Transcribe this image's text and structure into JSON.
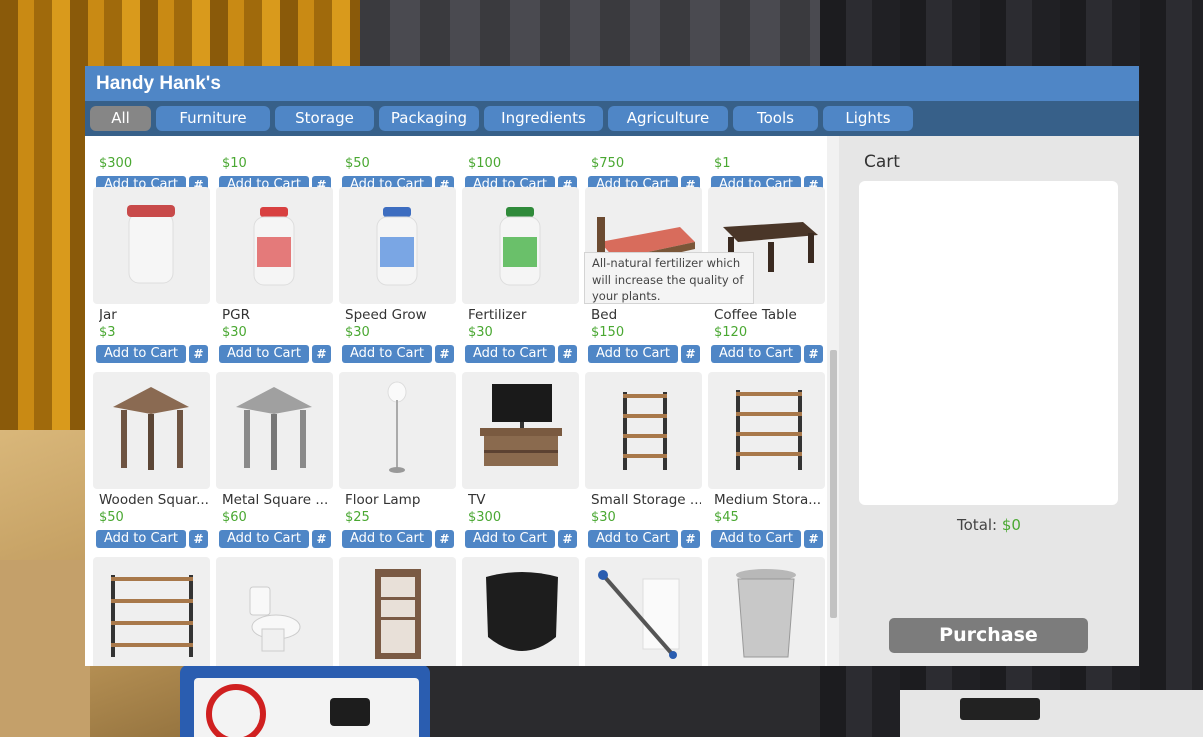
{
  "shop": {
    "title": "Handy Hank's",
    "tabs": [
      {
        "label": "All",
        "active": true
      },
      {
        "label": "Furniture",
        "active": false
      },
      {
        "label": "Storage",
        "active": false
      },
      {
        "label": "Packaging",
        "active": false
      },
      {
        "label": "Ingredients",
        "active": false
      },
      {
        "label": "Agriculture",
        "active": false
      },
      {
        "label": "Tools",
        "active": false
      },
      {
        "label": "Lights",
        "active": false
      }
    ],
    "add_to_cart_label": "Add to Cart",
    "qty_label": "#",
    "rows": [
      [
        {
          "name": "",
          "price": "$300",
          "icon": "item"
        },
        {
          "name": "",
          "price": "$10",
          "icon": "item"
        },
        {
          "name": "",
          "price": "$50",
          "icon": "item"
        },
        {
          "name": "",
          "price": "$100",
          "icon": "item"
        },
        {
          "name": "",
          "price": "$750",
          "icon": "item"
        },
        {
          "name": "",
          "price": "$1",
          "icon": "item"
        }
      ],
      [
        {
          "name": "Jar",
          "price": "$3",
          "icon": "jar-icon"
        },
        {
          "name": "PGR",
          "price": "$30",
          "icon": "pgr-bottle-icon"
        },
        {
          "name": "Speed Grow",
          "price": "$30",
          "icon": "speed-grow-bottle-icon"
        },
        {
          "name": "Fertilizer",
          "price": "$30",
          "icon": "fertilizer-bottle-icon"
        },
        {
          "name": "Bed",
          "price": "$150",
          "icon": "bed-icon"
        },
        {
          "name": "Coffee Table",
          "price": "$120",
          "icon": "coffee-table-icon"
        }
      ],
      [
        {
          "name": "Wooden Squar...",
          "price": "$50",
          "icon": "wooden-table-icon"
        },
        {
          "name": "Metal Square ...",
          "price": "$60",
          "icon": "metal-table-icon"
        },
        {
          "name": "Floor Lamp",
          "price": "$25",
          "icon": "floor-lamp-icon"
        },
        {
          "name": "TV",
          "price": "$300",
          "icon": "tv-icon"
        },
        {
          "name": "Small Storage ...",
          "price": "$30",
          "icon": "small-rack-icon"
        },
        {
          "name": "Medium Stora...",
          "price": "$45",
          "icon": "medium-rack-icon"
        }
      ],
      [
        {
          "name": "",
          "price": "",
          "icon": "large-rack-icon"
        },
        {
          "name": "",
          "price": "",
          "icon": "toilet-icon"
        },
        {
          "name": "",
          "price": "",
          "icon": "display-cabinet-icon"
        },
        {
          "name": "",
          "price": "",
          "icon": "trash-bag-icon"
        },
        {
          "name": "",
          "price": "",
          "icon": "trash-grabber-icon"
        },
        {
          "name": "",
          "price": "",
          "icon": "trash-can-icon"
        }
      ]
    ],
    "tooltip": "All-natural fertilizer which will increase the quality of your plants.",
    "cart": {
      "title": "Cart",
      "total_label": "Total:",
      "total_value": "$0",
      "purchase_label": "Purchase"
    }
  },
  "colors": {
    "accent": "#4f86c6",
    "tab_bar": "#376089",
    "active_tab": "#868686",
    "price_green": "#4aa832"
  }
}
